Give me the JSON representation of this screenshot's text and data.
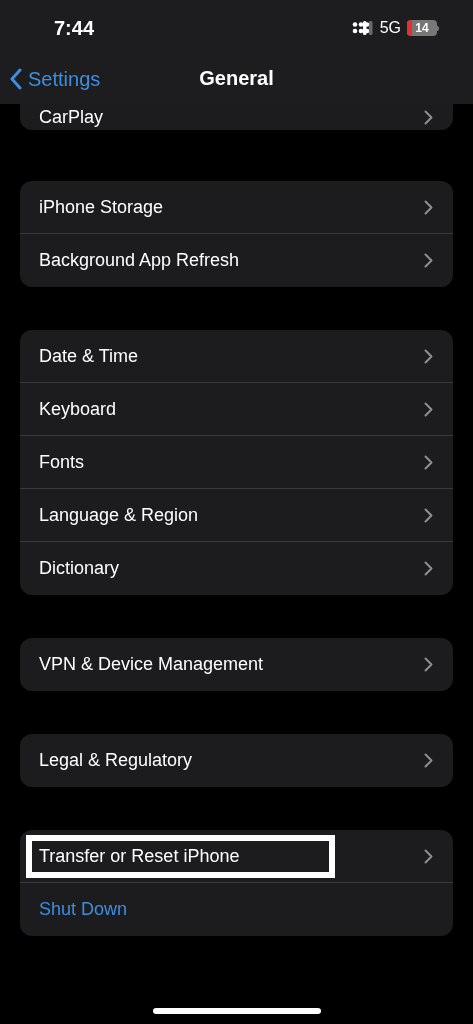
{
  "status_bar": {
    "time": "7:44",
    "network": "5G",
    "battery": "14"
  },
  "nav": {
    "back": "Settings",
    "title": "General"
  },
  "groups": [
    {
      "rows": [
        {
          "label": "CarPlay",
          "kind": "link",
          "highlighted": false
        }
      ]
    },
    {
      "rows": [
        {
          "label": "iPhone Storage",
          "kind": "link",
          "highlighted": false
        },
        {
          "label": "Background App Refresh",
          "kind": "link",
          "highlighted": false
        }
      ]
    },
    {
      "rows": [
        {
          "label": "Date & Time",
          "kind": "link",
          "highlighted": false
        },
        {
          "label": "Keyboard",
          "kind": "link",
          "highlighted": false
        },
        {
          "label": "Fonts",
          "kind": "link",
          "highlighted": false
        },
        {
          "label": "Language & Region",
          "kind": "link",
          "highlighted": false
        },
        {
          "label": "Dictionary",
          "kind": "link",
          "highlighted": false
        }
      ]
    },
    {
      "rows": [
        {
          "label": "VPN & Device Management",
          "kind": "link",
          "highlighted": false
        }
      ]
    },
    {
      "rows": [
        {
          "label": "Legal & Regulatory",
          "kind": "link",
          "highlighted": false
        }
      ]
    },
    {
      "rows": [
        {
          "label": "Transfer or Reset iPhone",
          "kind": "link",
          "highlighted": true
        },
        {
          "label": "Shut Down",
          "kind": "action",
          "highlighted": false
        }
      ]
    }
  ]
}
